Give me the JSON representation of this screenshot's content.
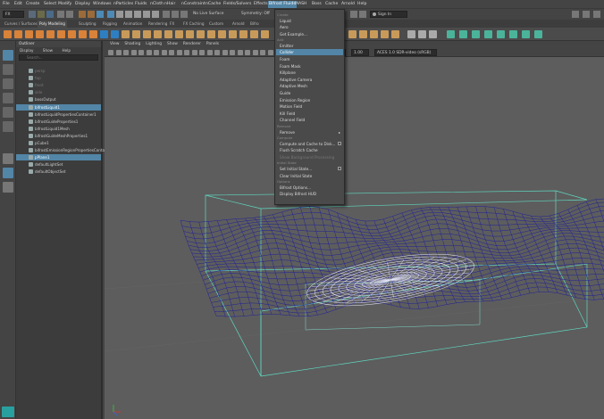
{
  "menubar": [
    "File",
    "Edit",
    "Create",
    "Select",
    "Modify",
    "Display",
    "Windows",
    "nParticles",
    "Fluids",
    "nCloth",
    "nHair",
    "nConstraint",
    "nCache",
    "Fields/Solvers",
    "Effects",
    "Bifrost Fluids",
    "MASH",
    "Boss",
    "Cache",
    "Arnold",
    "Help"
  ],
  "menubar_active": "Bifrost Fluids",
  "status": {
    "live_surface": "No Live Surface",
    "symmetry": "Symmetry: Off",
    "sign_in": "Sign In"
  },
  "shelf_tabs": [
    "Curves / Surfaces",
    "Poly Modeling",
    "Sculpting",
    "Rigging",
    "Animation",
    "Rendering",
    "FX",
    "FX Caching",
    "Custom",
    "Arnold",
    "Bifro"
  ],
  "shelf_tab_active": "Poly Modeling",
  "outliner": {
    "title": "Outliner",
    "menus": [
      "Display",
      "Show",
      "Help"
    ],
    "search_placeholder": "Search...",
    "rows": [
      {
        "label": "persp",
        "sel": false,
        "dim": true
      },
      {
        "label": "top",
        "sel": false,
        "dim": true
      },
      {
        "label": "front",
        "sel": false,
        "dim": true
      },
      {
        "label": "side",
        "sel": false,
        "dim": true
      },
      {
        "label": "bossOutput",
        "sel": false,
        "dim": false
      },
      {
        "label": "bifrostLiquid1",
        "sel": true,
        "dim": false
      },
      {
        "label": "bifrostLiquidPropertiesContainer1",
        "sel": false,
        "dim": false
      },
      {
        "label": "bifrostGuideProperties1",
        "sel": false,
        "dim": false
      },
      {
        "label": "bifrostLiquid1Mesh",
        "sel": false,
        "dim": false
      },
      {
        "label": "bifrostGuideMeshProperties1",
        "sel": false,
        "dim": false
      },
      {
        "label": "pCube1",
        "sel": false,
        "dim": false
      },
      {
        "label": "bifrostEmissionRegionPropertiesContainer1",
        "sel": false,
        "dim": false
      },
      {
        "label": "pPlane1",
        "sel": true,
        "dim": false
      },
      {
        "label": "defaultLightSet",
        "sel": false,
        "dim": false
      },
      {
        "label": "defaultObjectSet",
        "sel": false,
        "dim": false
      }
    ]
  },
  "viewport": {
    "menus": [
      "View",
      "Shading",
      "Lighting",
      "Show",
      "Renderer",
      "Panels"
    ],
    "exposure": "0.00",
    "gamma": "1.00",
    "colorspace": "ACES 1.0 SDR-video (sRGB)"
  },
  "dropdown": {
    "sections": [
      {
        "heading": "Create",
        "items": [
          {
            "label": "Liquid"
          },
          {
            "label": "Aero"
          },
          {
            "label": "Get Example..."
          }
        ]
      },
      {
        "heading": "Add",
        "items": [
          {
            "label": "Emitter"
          },
          {
            "label": "Collider",
            "highlight": true
          },
          {
            "label": "Foam"
          },
          {
            "label": "Foam Mask"
          },
          {
            "label": "Killplane"
          },
          {
            "label": "Adaptive Camera"
          },
          {
            "label": "Adaptive Mesh"
          },
          {
            "label": "Guide"
          },
          {
            "label": "Emission Region"
          },
          {
            "label": "Motion Field"
          },
          {
            "label": "Kill Field"
          },
          {
            "label": "Channel Field"
          }
        ]
      },
      {
        "heading": "Remove",
        "items": [
          {
            "label": "Remove",
            "submenu": true
          }
        ]
      },
      {
        "heading": "Compute",
        "items": [
          {
            "label": "Compute and Cache to Disk...",
            "option": true
          },
          {
            "label": "Flush Scratch Cache"
          },
          {
            "label": "Show Background Processing",
            "disabled": true
          }
        ]
      },
      {
        "heading": "Initial State",
        "items": [
          {
            "label": "Set Initial State...",
            "option": true
          },
          {
            "label": "Clear Initial State"
          }
        ]
      },
      {
        "heading": "Options",
        "items": [
          {
            "label": "Bifrost Options..."
          },
          {
            "label": "Display Bifrost HUD"
          }
        ]
      }
    ]
  },
  "colors": {
    "accent": "#5285a6",
    "mesh": "#1a1a9e",
    "box": "#5fd8c0",
    "foam": "#e8e8ff"
  }
}
